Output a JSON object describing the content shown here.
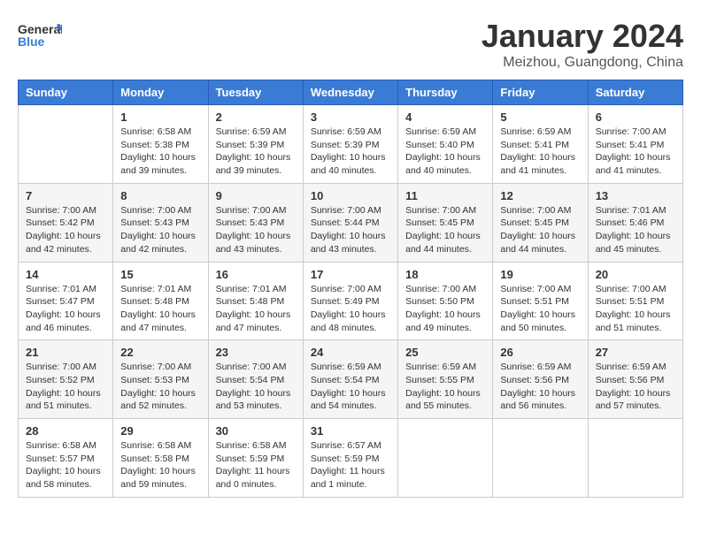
{
  "app": {
    "logo_general": "General",
    "logo_blue": "Blue"
  },
  "header": {
    "month": "January 2024",
    "location": "Meizhou, Guangdong, China"
  },
  "weekdays": [
    "Sunday",
    "Monday",
    "Tuesday",
    "Wednesday",
    "Thursday",
    "Friday",
    "Saturday"
  ],
  "weeks": [
    [
      {
        "day": "",
        "sunrise": "",
        "sunset": "",
        "daylight": ""
      },
      {
        "day": "1",
        "sunrise": "Sunrise: 6:58 AM",
        "sunset": "Sunset: 5:38 PM",
        "daylight": "Daylight: 10 hours and 39 minutes."
      },
      {
        "day": "2",
        "sunrise": "Sunrise: 6:59 AM",
        "sunset": "Sunset: 5:39 PM",
        "daylight": "Daylight: 10 hours and 39 minutes."
      },
      {
        "day": "3",
        "sunrise": "Sunrise: 6:59 AM",
        "sunset": "Sunset: 5:39 PM",
        "daylight": "Daylight: 10 hours and 40 minutes."
      },
      {
        "day": "4",
        "sunrise": "Sunrise: 6:59 AM",
        "sunset": "Sunset: 5:40 PM",
        "daylight": "Daylight: 10 hours and 40 minutes."
      },
      {
        "day": "5",
        "sunrise": "Sunrise: 6:59 AM",
        "sunset": "Sunset: 5:41 PM",
        "daylight": "Daylight: 10 hours and 41 minutes."
      },
      {
        "day": "6",
        "sunrise": "Sunrise: 7:00 AM",
        "sunset": "Sunset: 5:41 PM",
        "daylight": "Daylight: 10 hours and 41 minutes."
      }
    ],
    [
      {
        "day": "7",
        "sunrise": "Sunrise: 7:00 AM",
        "sunset": "Sunset: 5:42 PM",
        "daylight": "Daylight: 10 hours and 42 minutes."
      },
      {
        "day": "8",
        "sunrise": "Sunrise: 7:00 AM",
        "sunset": "Sunset: 5:43 PM",
        "daylight": "Daylight: 10 hours and 42 minutes."
      },
      {
        "day": "9",
        "sunrise": "Sunrise: 7:00 AM",
        "sunset": "Sunset: 5:43 PM",
        "daylight": "Daylight: 10 hours and 43 minutes."
      },
      {
        "day": "10",
        "sunrise": "Sunrise: 7:00 AM",
        "sunset": "Sunset: 5:44 PM",
        "daylight": "Daylight: 10 hours and 43 minutes."
      },
      {
        "day": "11",
        "sunrise": "Sunrise: 7:00 AM",
        "sunset": "Sunset: 5:45 PM",
        "daylight": "Daylight: 10 hours and 44 minutes."
      },
      {
        "day": "12",
        "sunrise": "Sunrise: 7:00 AM",
        "sunset": "Sunset: 5:45 PM",
        "daylight": "Daylight: 10 hours and 44 minutes."
      },
      {
        "day": "13",
        "sunrise": "Sunrise: 7:01 AM",
        "sunset": "Sunset: 5:46 PM",
        "daylight": "Daylight: 10 hours and 45 minutes."
      }
    ],
    [
      {
        "day": "14",
        "sunrise": "Sunrise: 7:01 AM",
        "sunset": "Sunset: 5:47 PM",
        "daylight": "Daylight: 10 hours and 46 minutes."
      },
      {
        "day": "15",
        "sunrise": "Sunrise: 7:01 AM",
        "sunset": "Sunset: 5:48 PM",
        "daylight": "Daylight: 10 hours and 47 minutes."
      },
      {
        "day": "16",
        "sunrise": "Sunrise: 7:01 AM",
        "sunset": "Sunset: 5:48 PM",
        "daylight": "Daylight: 10 hours and 47 minutes."
      },
      {
        "day": "17",
        "sunrise": "Sunrise: 7:00 AM",
        "sunset": "Sunset: 5:49 PM",
        "daylight": "Daylight: 10 hours and 48 minutes."
      },
      {
        "day": "18",
        "sunrise": "Sunrise: 7:00 AM",
        "sunset": "Sunset: 5:50 PM",
        "daylight": "Daylight: 10 hours and 49 minutes."
      },
      {
        "day": "19",
        "sunrise": "Sunrise: 7:00 AM",
        "sunset": "Sunset: 5:51 PM",
        "daylight": "Daylight: 10 hours and 50 minutes."
      },
      {
        "day": "20",
        "sunrise": "Sunrise: 7:00 AM",
        "sunset": "Sunset: 5:51 PM",
        "daylight": "Daylight: 10 hours and 51 minutes."
      }
    ],
    [
      {
        "day": "21",
        "sunrise": "Sunrise: 7:00 AM",
        "sunset": "Sunset: 5:52 PM",
        "daylight": "Daylight: 10 hours and 51 minutes."
      },
      {
        "day": "22",
        "sunrise": "Sunrise: 7:00 AM",
        "sunset": "Sunset: 5:53 PM",
        "daylight": "Daylight: 10 hours and 52 minutes."
      },
      {
        "day": "23",
        "sunrise": "Sunrise: 7:00 AM",
        "sunset": "Sunset: 5:54 PM",
        "daylight": "Daylight: 10 hours and 53 minutes."
      },
      {
        "day": "24",
        "sunrise": "Sunrise: 6:59 AM",
        "sunset": "Sunset: 5:54 PM",
        "daylight": "Daylight: 10 hours and 54 minutes."
      },
      {
        "day": "25",
        "sunrise": "Sunrise: 6:59 AM",
        "sunset": "Sunset: 5:55 PM",
        "daylight": "Daylight: 10 hours and 55 minutes."
      },
      {
        "day": "26",
        "sunrise": "Sunrise: 6:59 AM",
        "sunset": "Sunset: 5:56 PM",
        "daylight": "Daylight: 10 hours and 56 minutes."
      },
      {
        "day": "27",
        "sunrise": "Sunrise: 6:59 AM",
        "sunset": "Sunset: 5:56 PM",
        "daylight": "Daylight: 10 hours and 57 minutes."
      }
    ],
    [
      {
        "day": "28",
        "sunrise": "Sunrise: 6:58 AM",
        "sunset": "Sunset: 5:57 PM",
        "daylight": "Daylight: 10 hours and 58 minutes."
      },
      {
        "day": "29",
        "sunrise": "Sunrise: 6:58 AM",
        "sunset": "Sunset: 5:58 PM",
        "daylight": "Daylight: 10 hours and 59 minutes."
      },
      {
        "day": "30",
        "sunrise": "Sunrise: 6:58 AM",
        "sunset": "Sunset: 5:59 PM",
        "daylight": "Daylight: 11 hours and 0 minutes."
      },
      {
        "day": "31",
        "sunrise": "Sunrise: 6:57 AM",
        "sunset": "Sunset: 5:59 PM",
        "daylight": "Daylight: 11 hours and 1 minute."
      },
      {
        "day": "",
        "sunrise": "",
        "sunset": "",
        "daylight": ""
      },
      {
        "day": "",
        "sunrise": "",
        "sunset": "",
        "daylight": ""
      },
      {
        "day": "",
        "sunrise": "",
        "sunset": "",
        "daylight": ""
      }
    ]
  ]
}
